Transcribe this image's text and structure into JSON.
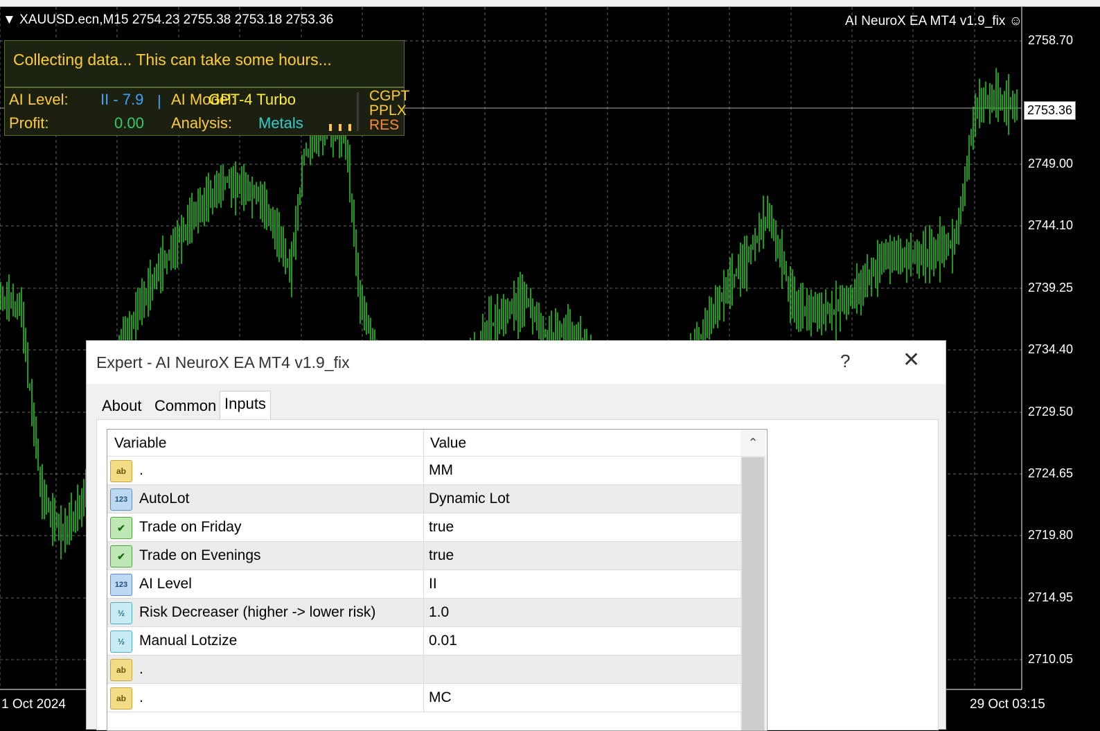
{
  "chart": {
    "symbol_line": "XAUUSD.ecn,M15  2754.23 2755.38 2753.18 2753.36",
    "ea_title": "AI NeuroX EA MT4 v1.9_fix",
    "price_ticks": [
      "2758.70",
      "2749.00",
      "2744.10",
      "2739.25",
      "2734.40",
      "2729.50",
      "2724.65",
      "2719.80",
      "2714.95",
      "2710.05"
    ],
    "current_price": "2753.36",
    "date_left": "1 Oct 2024",
    "date_right": "29 Oct 03:15",
    "colors": {
      "background": "#000000",
      "bars": "#22c322",
      "grid": "#c0c0c0"
    }
  },
  "overlay": {
    "status": "Collecting data... This can take some hours...",
    "ai_level_label": "AI Level:",
    "ai_level_value": "II - 7.9",
    "ai_model_label": "AI Model:",
    "ai_model_value": "GPT-4 Turbo",
    "profit_label": "Profit:",
    "profit_value": "0.00",
    "analysis_label": "Analysis:",
    "analysis_value": "Metals",
    "providers": [
      "CGPT",
      "PPLX",
      "RES"
    ]
  },
  "dialog": {
    "title": "Expert - AI NeuroX EA MT4 v1.9_fix",
    "help": "?",
    "tabs": [
      "About",
      "Common",
      "Inputs"
    ],
    "active_tab": "Inputs",
    "columns": {
      "variable": "Variable",
      "value": "Value"
    },
    "rows": [
      {
        "icon": "ab",
        "variable": ".",
        "value": "MM"
      },
      {
        "icon": "123",
        "variable": "AutoLot",
        "value": "Dynamic Lot"
      },
      {
        "icon": "bool",
        "variable": "Trade on Friday",
        "value": "true"
      },
      {
        "icon": "bool",
        "variable": "Trade on Evenings",
        "value": "true"
      },
      {
        "icon": "123",
        "variable": "AI Level",
        "value": "II"
      },
      {
        "icon": "v2",
        "variable": "Risk Decreaser (higher -> lower risk)",
        "value": "1.0"
      },
      {
        "icon": "v2",
        "variable": "Manual Lotzize",
        "value": "0.01"
      },
      {
        "icon": "ab",
        "variable": ".",
        "value": ""
      },
      {
        "icon": "ab",
        "variable": ".",
        "value": "MC"
      }
    ]
  }
}
